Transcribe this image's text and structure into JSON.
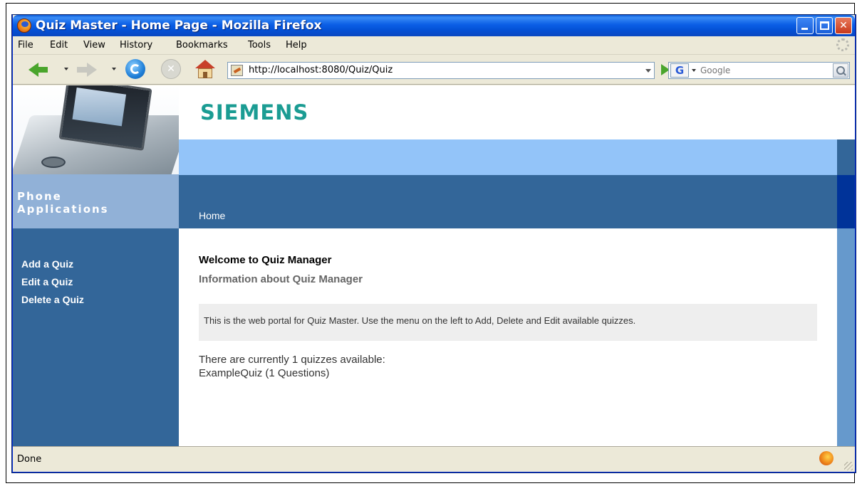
{
  "window": {
    "title": "Quiz Master - Home Page - Mozilla Firefox"
  },
  "menubar": {
    "items": [
      "File",
      "Edit",
      "View",
      "History",
      "Bookmarks",
      "Tools",
      "Help"
    ]
  },
  "navbar": {
    "url": "http://localhost:8080/Quiz/Quiz",
    "search_engine": "G",
    "search_placeholder": "Google"
  },
  "page": {
    "logo": "SIEMENS",
    "brand_label_line1": "Phone",
    "brand_label_line2": "Applications",
    "breadcrumb": "Home",
    "sidebar_links": [
      "Add a Quiz",
      "Edit a Quiz",
      "Delete a Quiz"
    ],
    "heading": "Welcome to Quiz Manager",
    "subheading": "Information about Quiz Manager",
    "info_text": "This is the web portal for Quiz Master. Use the menu on the left to Add, Delete and Edit available quizzes.",
    "count_text": "There are currently 1 quizzes available:",
    "quiz_list": [
      "ExampleQuiz (1 Questions)"
    ]
  },
  "statusbar": {
    "text": "Done"
  },
  "colors": {
    "sidebar": "#336699",
    "band_light": "#93c4f9",
    "logo": "#1b9c93",
    "xp_titlebar": "#0451d6"
  },
  "icons": [
    "firefox-icon",
    "back-icon",
    "forward-icon",
    "reload-icon",
    "stop-icon",
    "home-icon",
    "page-favicon",
    "go-icon",
    "search-icon",
    "throbber-icon"
  ]
}
